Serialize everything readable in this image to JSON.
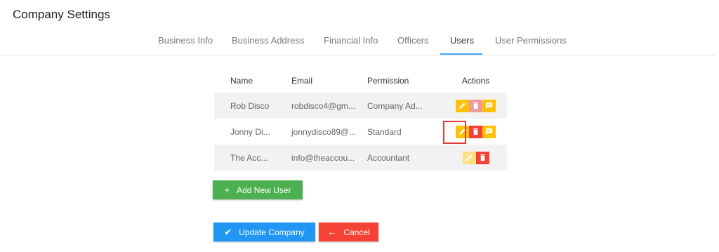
{
  "page_title": "Company Settings",
  "tabs": [
    {
      "label": "Business Info"
    },
    {
      "label": "Business Address"
    },
    {
      "label": "Financial Info"
    },
    {
      "label": "Officers"
    },
    {
      "label": "Users",
      "active": true
    },
    {
      "label": "User Permissions"
    }
  ],
  "table": {
    "headers": {
      "name": "Name",
      "email": "Email",
      "permission": "Permission",
      "actions": "Actions"
    },
    "rows": [
      {
        "name": "Rob Disco",
        "email": "robdisco4@gm...",
        "permission": "Company Ad...",
        "actions": [
          "edit",
          "delete",
          "note"
        ]
      },
      {
        "name": "Jonny Di...",
        "email": "jonnydisco89@...",
        "permission": "Standard",
        "actions": [
          "edit",
          "delete",
          "note"
        ]
      },
      {
        "name": "The Acc...",
        "email": "info@theaccou...",
        "permission": "Accountant",
        "actions": [
          "edit",
          "delete"
        ]
      }
    ]
  },
  "buttons": {
    "add_user": {
      "icon": "+",
      "label": "Add New User"
    },
    "update": {
      "icon": "✔",
      "label": "Update Company"
    },
    "cancel": {
      "icon": "←",
      "label": "Cancel"
    }
  },
  "colors": {
    "accent": "#42a5f5",
    "edit": "#ffc107",
    "delete": "#f44336",
    "add": "#4caf50",
    "update": "#2196f3",
    "cancel": "#f44336"
  },
  "icons": {
    "edit": "pencil-icon",
    "delete": "trash-icon",
    "note": "comment-icon"
  }
}
